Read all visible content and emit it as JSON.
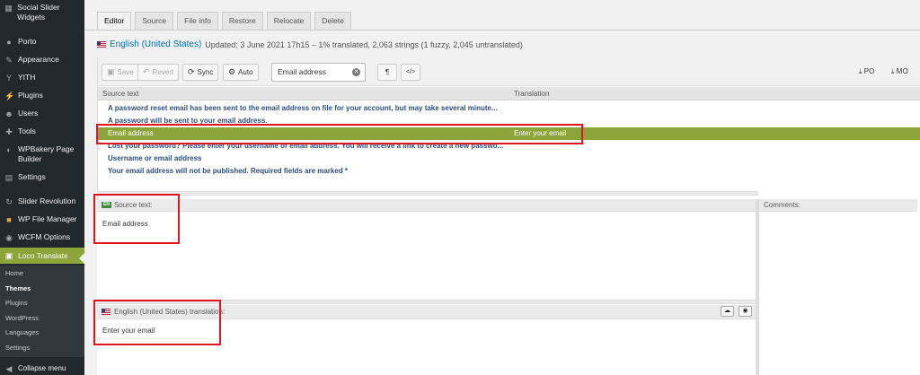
{
  "sidebar": {
    "items": [
      {
        "label": "Social Slider Widgets",
        "icon": "widget-icon"
      },
      {
        "label": "Porto",
        "icon": "porto-icon"
      },
      {
        "label": "Appearance",
        "icon": "paintbrush-icon"
      },
      {
        "label": "YITH",
        "icon": "yith-icon"
      },
      {
        "label": "Plugins",
        "icon": "plug-icon"
      },
      {
        "label": "Users",
        "icon": "users-icon"
      },
      {
        "label": "Tools",
        "icon": "wrench-icon"
      },
      {
        "label": "WPBakery Page Builder",
        "icon": "wpbakery-icon"
      },
      {
        "label": "Settings",
        "icon": "settings-icon"
      },
      {
        "label": "Slider Revolution",
        "icon": "slider-icon"
      },
      {
        "label": "WP File Manager",
        "icon": "file-manager-icon"
      },
      {
        "label": "WCFM Options",
        "icon": "wcfm-icon"
      },
      {
        "label": "Loco Translate",
        "icon": "translate-icon"
      }
    ],
    "submenu": [
      "Home",
      "Themes",
      "Plugins",
      "WordPress",
      "Languages",
      "Settings"
    ],
    "submenu_current": "Themes",
    "collapse_label": "Collapse menu"
  },
  "tabs": [
    "Editor",
    "Source",
    "File info",
    "Restore",
    "Relocate",
    "Delete"
  ],
  "active_tab": "Editor",
  "header": {
    "language": "English (United States)",
    "status": "Updated: 3 June 2021 17h15 – 1% translated, 2,063 strings (1 fuzzy, 2,045 untranslated)"
  },
  "toolbar": {
    "save": "Save",
    "revert": "Revert",
    "sync": "Sync",
    "auto": "Auto",
    "search_value": "Email address",
    "pilcrow": "¶",
    "code": "</>",
    "po": "PO",
    "mo": "MO"
  },
  "grid": {
    "headers": {
      "source": "Source text",
      "translation": "Translation"
    },
    "rows": [
      {
        "source": "A password reset email has been sent to the email address on file for your account, but may take several minute...",
        "translation": ""
      },
      {
        "source": "A password will be sent to your email address.",
        "translation": ""
      },
      {
        "source": "Email address",
        "translation": "Enter your email"
      },
      {
        "source": "Lost your password? Please enter your username or email address. You will receive a link to create a new passwo...",
        "translation": ""
      },
      {
        "source": "Username or email address",
        "translation": ""
      },
      {
        "source": "Your email address will not be published. Required fields are marked *",
        "translation": ""
      }
    ],
    "selected_index": 2
  },
  "source_pane": {
    "badge": "EN",
    "label": "Source text:",
    "text": "Email address"
  },
  "translation_pane": {
    "label": "English (United States) translation:",
    "text": "Enter your email"
  },
  "comments_pane": {
    "label": "Comments:"
  },
  "colors": {
    "sidebar_bg": "#23282d",
    "accent_green": "#8ba53a",
    "link_blue": "#0073aa",
    "highlight_red": "#e0161e"
  }
}
